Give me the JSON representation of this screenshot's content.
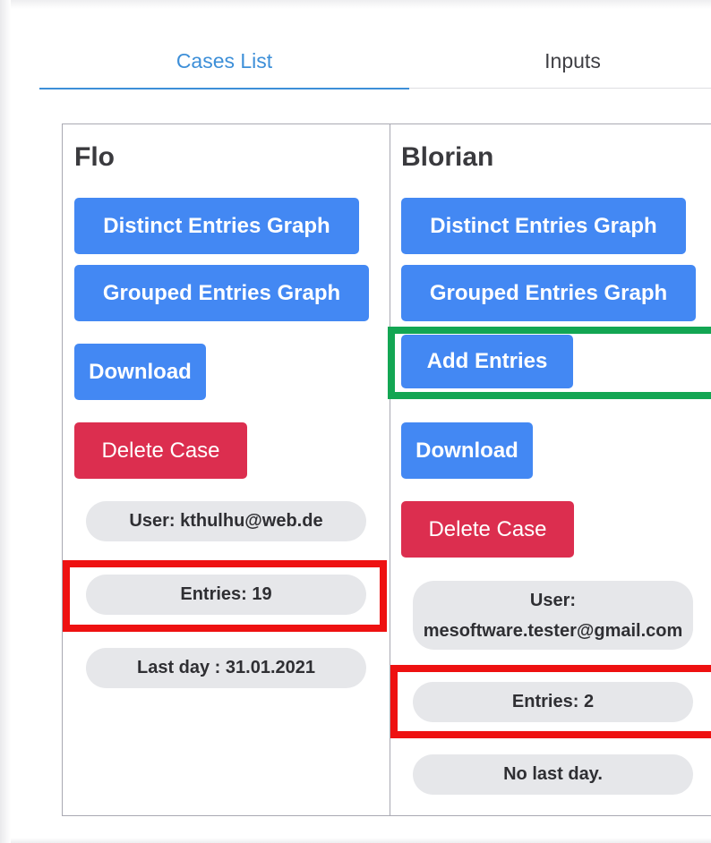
{
  "tabs": [
    {
      "label": "Cases List",
      "active": true
    },
    {
      "label": "Inputs",
      "active": false
    }
  ],
  "cases": [
    {
      "name": "Flo",
      "distinct_graph_label": "Distinct Entries Graph",
      "grouped_graph_label": "Grouped Entries Graph",
      "download_label": "Download",
      "delete_label": "Delete Case",
      "user": "User: kthulhu@web.de",
      "entries": "Entries: 19",
      "last_day": "Last day : 31.01.2021"
    },
    {
      "name": "Blorian",
      "distinct_graph_label": "Distinct Entries Graph",
      "grouped_graph_label": "Grouped Entries Graph",
      "add_entries_label": "Add Entries",
      "download_label": "Download",
      "delete_label": "Delete Case",
      "user_line1": "User:",
      "user_line2": "mesoftware.tester@gmail.com",
      "entries": "Entries: 2",
      "last_day": "No last day."
    }
  ],
  "colors": {
    "accent_tab": "#3d8fd8",
    "primary_button": "#4388f3",
    "danger_button": "#dc2e4f",
    "pill_background": "#e6e7ea",
    "highlight_red": "#ee1111",
    "highlight_green": "#13a653"
  }
}
